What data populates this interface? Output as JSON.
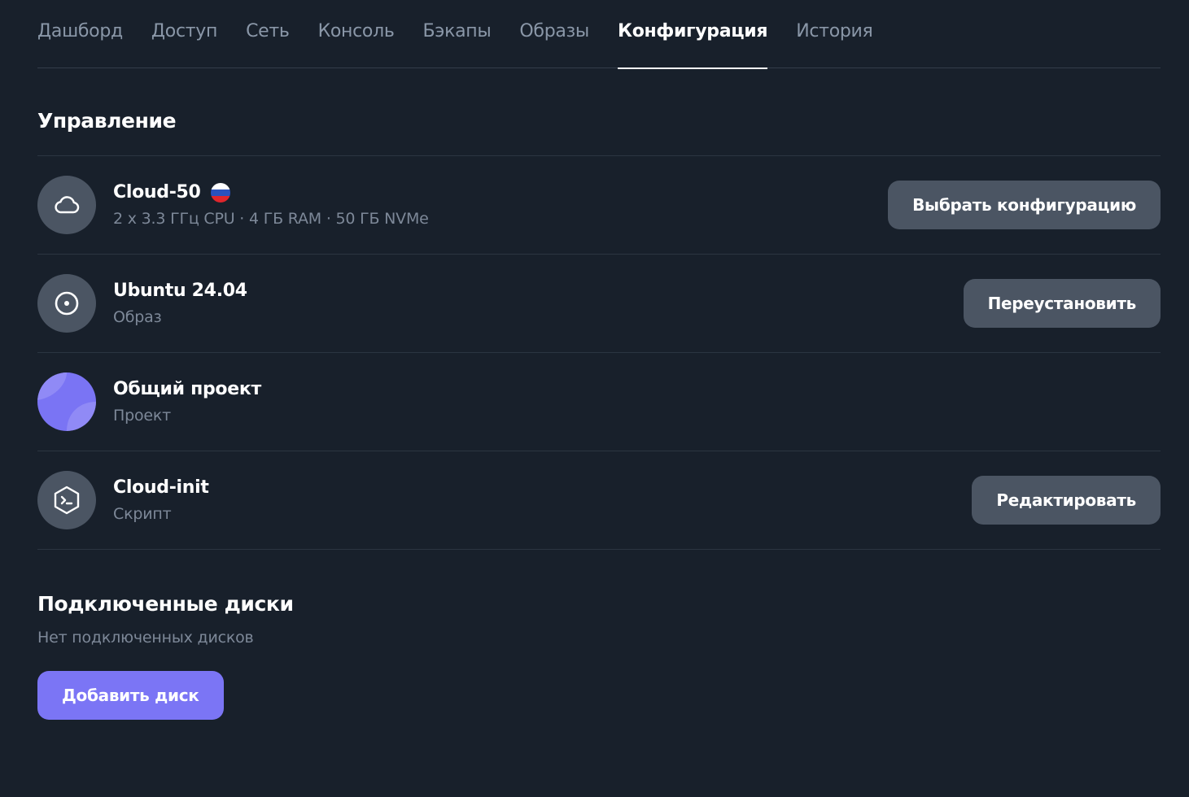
{
  "tabs": [
    {
      "label": "Дашборд",
      "active": false
    },
    {
      "label": "Доступ",
      "active": false
    },
    {
      "label": "Сеть",
      "active": false
    },
    {
      "label": "Консоль",
      "active": false
    },
    {
      "label": "Бэкапы",
      "active": false
    },
    {
      "label": "Образы",
      "active": false
    },
    {
      "label": "Конфигурация",
      "active": true
    },
    {
      "label": "История",
      "active": false
    }
  ],
  "management": {
    "title": "Управление",
    "rows": [
      {
        "icon": "cloud-icon",
        "title": "Cloud-50",
        "region_flag": "russia-flag-icon",
        "subtitle": "2 x 3.3 ГГц CPU · 4 ГБ RAM · 50 ГБ NVMe",
        "button": "Выбрать конфигурацию"
      },
      {
        "icon": "disc-icon",
        "title": "Ubuntu 24.04",
        "subtitle": "Образ",
        "button": "Переустановить"
      },
      {
        "icon": "project-avatar-icon",
        "title": "Общий проект",
        "subtitle": "Проект"
      },
      {
        "icon": "terminal-icon",
        "title": "Cloud-init",
        "subtitle": "Скрипт",
        "button": "Редактировать"
      }
    ]
  },
  "disks": {
    "title": "Подключенные диски",
    "empty_text": "Нет подключенных дисков",
    "add_button": "Добавить диск"
  },
  "colors": {
    "background": "#18202b",
    "accent": "#7b75f5",
    "secondary_button": "#4b5563",
    "muted_text": "#7d8898"
  }
}
